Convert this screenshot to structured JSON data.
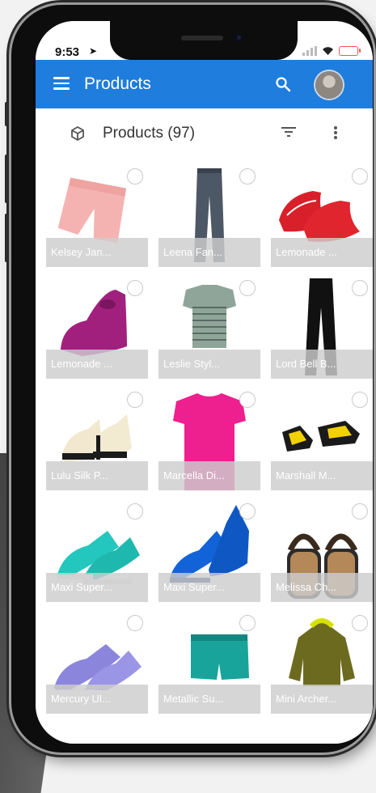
{
  "status_bar": {
    "time": "9:53"
  },
  "app_bar": {
    "title": "Products",
    "menu_icon": "menu-icon",
    "search_icon": "search-icon"
  },
  "sub_bar": {
    "label": "Products (97)",
    "icon": "cube-icon"
  },
  "products": [
    {
      "name": "Kelsey Jan...",
      "image": "pink-shorts"
    },
    {
      "name": "Leena Fan...",
      "image": "grey-pants"
    },
    {
      "name": "Lemonade ...",
      "image": "red-shoes"
    },
    {
      "name": "Lemonade ...",
      "image": "magenta-shoe"
    },
    {
      "name": "Leslie Styl...",
      "image": "striped-top"
    },
    {
      "name": "Lord Bell B...",
      "image": "black-pants"
    },
    {
      "name": "Lulu Silk P...",
      "image": "cream-heels"
    },
    {
      "name": "Marcella Di...",
      "image": "pink-tshirt"
    },
    {
      "name": "Marshall M...",
      "image": "yellow-sandals"
    },
    {
      "name": "Maxi Super...",
      "image": "teal-sneakers"
    },
    {
      "name": "Maxi Super...",
      "image": "blue-sneakers"
    },
    {
      "name": "Melissa Ch...",
      "image": "brown-sandals"
    },
    {
      "name": "Mercury Ul...",
      "image": "lavender-sneakers"
    },
    {
      "name": "Metallic Su...",
      "image": "teal-shorts"
    },
    {
      "name": "Mini Archer...",
      "image": "olive-jacket"
    }
  ],
  "colors": {
    "app_bar": "#1e7ddd",
    "caption_overlay": "#cdcdcd"
  }
}
